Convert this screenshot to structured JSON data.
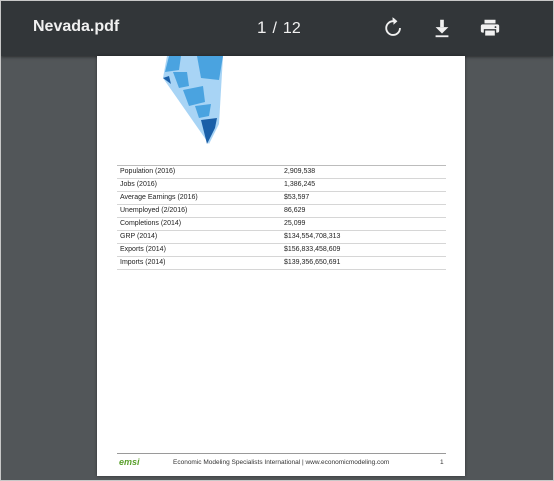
{
  "toolbar": {
    "title": "Nevada.pdf",
    "current_page": "1",
    "separator": "/",
    "total_pages": "12",
    "rotate_icon": "rotate-icon",
    "download_icon": "download-icon",
    "print_icon": "print-icon"
  },
  "stats": [
    {
      "label": "Population (2016)",
      "value": "2,909,538"
    },
    {
      "label": "Jobs (2016)",
      "value": "1,386,245"
    },
    {
      "label": "Average Earnings (2016)",
      "value": "$53,597"
    },
    {
      "label": "Unemployed (2/2016)",
      "value": "86,629"
    },
    {
      "label": "Completions (2014)",
      "value": "25,099"
    },
    {
      "label": "GRP (2014)",
      "value": "$134,554,708,313"
    },
    {
      "label": "Exports (2014)",
      "value": "$156,833,458,609"
    },
    {
      "label": "Imports (2014)",
      "value": "$139,356,650,691"
    }
  ],
  "footer": {
    "logo": "emsi",
    "text": "Economic Modeling Specialists International | www.economicmodeling.com",
    "page": "1"
  },
  "colors": {
    "toolbar_bg": "#323639",
    "viewer_bg": "#525659",
    "map_light": "#a8d4f5",
    "map_mid": "#4aa3e0",
    "map_dark": "#1a5fa8",
    "logo_green": "#5aa02c"
  }
}
